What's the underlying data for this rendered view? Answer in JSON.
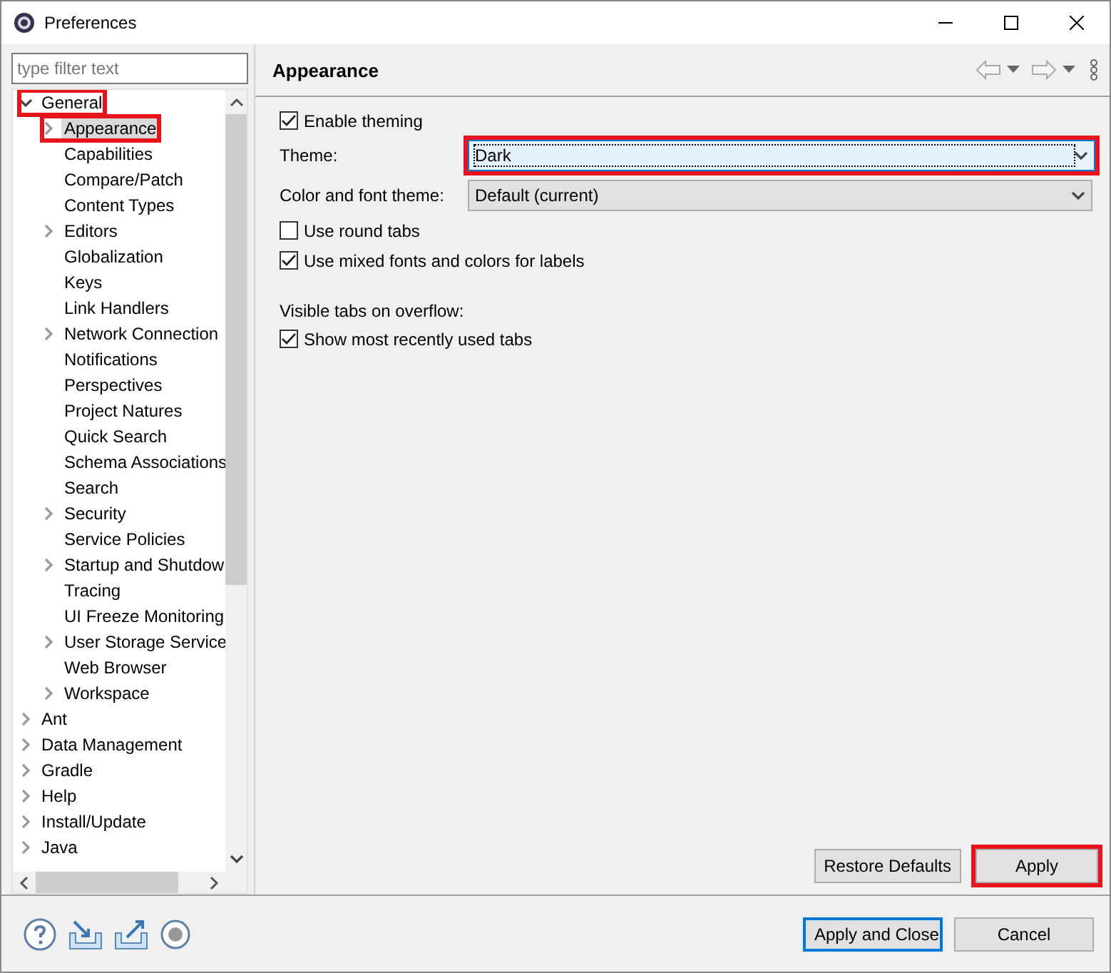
{
  "window": {
    "title": "Preferences"
  },
  "filter": {
    "placeholder": "type filter text"
  },
  "tree": [
    {
      "label": "General",
      "kind": "branch",
      "expanded": true,
      "selected": false,
      "highlighted": true,
      "children": [
        {
          "label": "Appearance",
          "kind": "branch",
          "expanded": false,
          "selected": true,
          "highlighted": true
        },
        {
          "label": "Capabilities",
          "kind": "leaf",
          "selected": false,
          "highlighted": false
        },
        {
          "label": "Compare/Patch",
          "kind": "leaf",
          "selected": false,
          "highlighted": false
        },
        {
          "label": "Content Types",
          "kind": "leaf",
          "selected": false,
          "highlighted": false
        },
        {
          "label": "Editors",
          "kind": "branch",
          "expanded": false,
          "selected": false,
          "highlighted": false
        },
        {
          "label": "Globalization",
          "kind": "leaf",
          "selected": false,
          "highlighted": false
        },
        {
          "label": "Keys",
          "kind": "leaf",
          "selected": false,
          "highlighted": false
        },
        {
          "label": "Link Handlers",
          "kind": "leaf",
          "selected": false,
          "highlighted": false
        },
        {
          "label": "Network Connection",
          "kind": "branch",
          "expanded": false,
          "selected": false,
          "highlighted": false
        },
        {
          "label": "Notifications",
          "kind": "leaf",
          "selected": false,
          "highlighted": false
        },
        {
          "label": "Perspectives",
          "kind": "leaf",
          "selected": false,
          "highlighted": false
        },
        {
          "label": "Project Natures",
          "kind": "leaf",
          "selected": false,
          "highlighted": false
        },
        {
          "label": "Quick Search",
          "kind": "leaf",
          "selected": false,
          "highlighted": false
        },
        {
          "label": "Schema Associations",
          "kind": "leaf",
          "selected": false,
          "highlighted": false
        },
        {
          "label": "Search",
          "kind": "leaf",
          "selected": false,
          "highlighted": false
        },
        {
          "label": "Security",
          "kind": "branch",
          "expanded": false,
          "selected": false,
          "highlighted": false
        },
        {
          "label": "Service Policies",
          "kind": "leaf",
          "selected": false,
          "highlighted": false
        },
        {
          "label": "Startup and Shutdow",
          "kind": "branch",
          "expanded": false,
          "selected": false,
          "highlighted": false
        },
        {
          "label": "Tracing",
          "kind": "leaf",
          "selected": false,
          "highlighted": false
        },
        {
          "label": "UI Freeze Monitoring",
          "kind": "leaf",
          "selected": false,
          "highlighted": false
        },
        {
          "label": "User Storage Service",
          "kind": "branch",
          "expanded": false,
          "selected": false,
          "highlighted": false
        },
        {
          "label": "Web Browser",
          "kind": "leaf",
          "selected": false,
          "highlighted": false
        },
        {
          "label": "Workspace",
          "kind": "branch",
          "expanded": false,
          "selected": false,
          "highlighted": false
        }
      ]
    },
    {
      "label": "Ant",
      "kind": "branch",
      "expanded": false,
      "selected": false,
      "highlighted": false
    },
    {
      "label": "Data Management",
      "kind": "branch",
      "expanded": false,
      "selected": false,
      "highlighted": false
    },
    {
      "label": "Gradle",
      "kind": "branch",
      "expanded": false,
      "selected": false,
      "highlighted": false
    },
    {
      "label": "Help",
      "kind": "branch",
      "expanded": false,
      "selected": false,
      "highlighted": false
    },
    {
      "label": "Install/Update",
      "kind": "branch",
      "expanded": false,
      "selected": false,
      "highlighted": false
    },
    {
      "label": "Java",
      "kind": "branch",
      "expanded": false,
      "selected": false,
      "highlighted": false
    }
  ],
  "page": {
    "title": "Appearance",
    "options": [
      {
        "kind": "checkbox",
        "label": "Enable theming",
        "checked": true,
        "highlighted": false
      },
      {
        "kind": "combo",
        "label": "Theme:",
        "value": "Dark",
        "focused": true,
        "highlighted": true
      },
      {
        "kind": "combo",
        "label": "Color and font theme:",
        "value": "Default (current)",
        "focused": false,
        "highlighted": false
      },
      {
        "kind": "checkbox",
        "label": "Use round tabs",
        "checked": false,
        "highlighted": false
      },
      {
        "kind": "checkbox",
        "label": "Use mixed fonts and colors for labels",
        "checked": true,
        "highlighted": false
      },
      {
        "kind": "heading",
        "label": "Visible tabs on overflow:",
        "highlighted": false
      },
      {
        "kind": "checkbox",
        "label": "Show most recently used tabs",
        "checked": true,
        "highlighted": false
      }
    ]
  },
  "page_buttons": [
    {
      "label": "Restore Defaults",
      "highlighted": false
    },
    {
      "label": "Apply",
      "highlighted": true
    }
  ],
  "dialog_buttons": [
    {
      "label": "Apply and Close",
      "default": true
    },
    {
      "label": "Cancel",
      "default": false
    }
  ]
}
